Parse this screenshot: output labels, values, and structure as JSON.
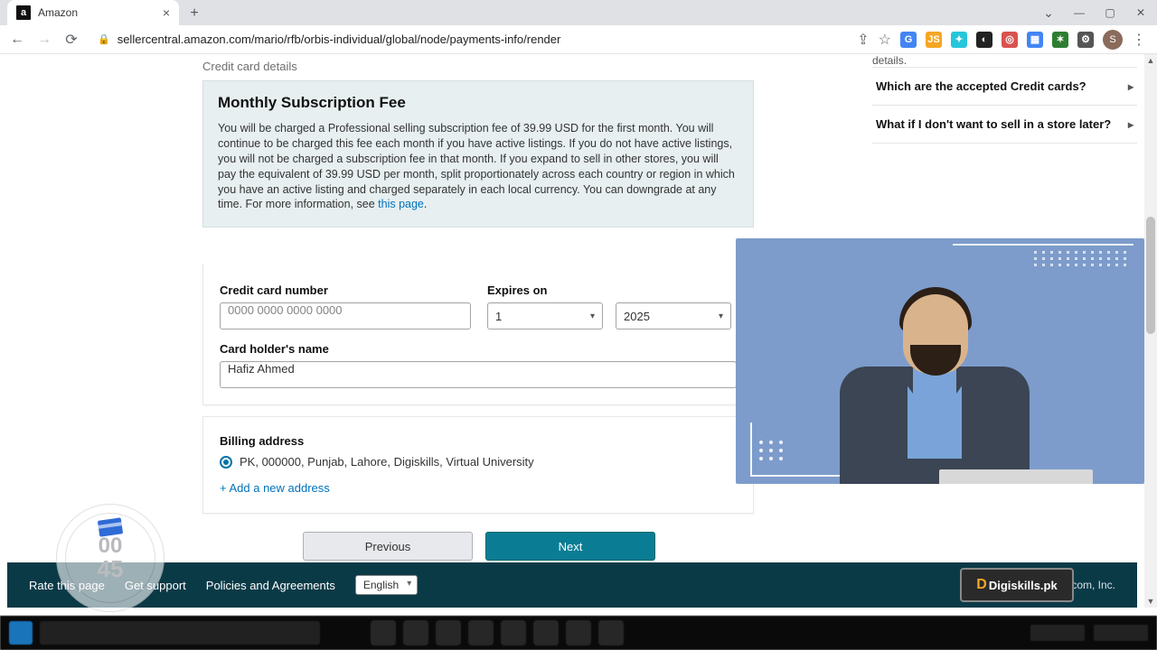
{
  "browser": {
    "tab_title": "Amazon",
    "favicon_letter": "a",
    "url": "sellercentral.amazon.com/mario/rfb/orbis-individual/global/node/payments-info/render"
  },
  "window_controls": {
    "chevron": "⌄",
    "min": "—",
    "max": "▢",
    "close": "✕"
  },
  "section_label": "Credit card details",
  "infobox": {
    "title": "Monthly Subscription Fee",
    "body_pre": "You will be charged a Professional selling subscription fee of 39.99 USD for the first month. You will continue to be charged this fee each month if you have active listings. If you do not have active listings, you will not be charged a subscription fee in that month. If you expand to sell in other stores, you will pay the equivalent of 39.99 USD per month, split proportionately across each country or region in which you have an active listing and charged separately in each local currency. You can downgrade at any time. For more information, see ",
    "link": "this page",
    "body_post": "."
  },
  "form": {
    "cc_label": "Credit card number",
    "cc_placeholder": "0000 0000 0000 0000",
    "exp_label": "Expires on",
    "exp_month": "1",
    "exp_year": "2025",
    "holder_label": "Card holder's name",
    "holder_value": "Hafiz Ahmed"
  },
  "billing": {
    "label": "Billing address",
    "address": "PK, 000000, Punjab, Lahore, Digiskills, Virtual University",
    "add_link": "+ Add a new address"
  },
  "nav": {
    "prev": "Previous",
    "next": "Next"
  },
  "faq": {
    "hint": "details.",
    "q1": "Which are the accepted Credit cards?",
    "q2": "What if I don't want to sell in a store later?"
  },
  "footer": {
    "rate": "Rate this page",
    "support": "Get support",
    "policies": "Policies and Agreements",
    "lang": "English",
    "copy": "n.com, Inc."
  },
  "timer": {
    "top": "00",
    "bottom": "45"
  },
  "badge": {
    "d": "D",
    "text": "Digiskills.pk"
  },
  "ext_avatar": "S"
}
